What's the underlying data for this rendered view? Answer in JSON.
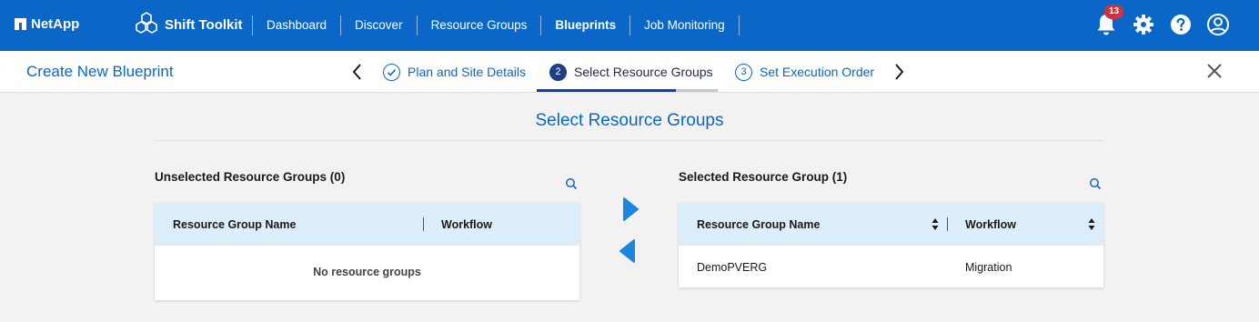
{
  "brand": {
    "name": "NetApp"
  },
  "product": {
    "name": "Shift Toolkit"
  },
  "nav": {
    "items": [
      {
        "label": "Dashboard",
        "active": false
      },
      {
        "label": "Discover",
        "active": false
      },
      {
        "label": "Resource Groups",
        "active": false
      },
      {
        "label": "Blueprints",
        "active": true
      },
      {
        "label": "Job Monitoring",
        "active": false
      }
    ],
    "notifications_count": "13"
  },
  "wizard": {
    "title": "Create New Blueprint",
    "steps": [
      {
        "number": "✓",
        "label": "Plan and Site Details",
        "state": "done"
      },
      {
        "number": "2",
        "label": "Select Resource Groups",
        "state": "current"
      },
      {
        "number": "3",
        "label": "Set Execution Order",
        "state": "todo"
      }
    ]
  },
  "main": {
    "title": "Select Resource Groups",
    "unselected": {
      "title": "Unselected Resource Groups (0)",
      "columns": [
        "Resource Group Name",
        "Workflow"
      ],
      "empty_message": "No resource groups",
      "rows": []
    },
    "selected": {
      "title": "Selected Resource Group (1)",
      "columns": [
        "Resource Group Name",
        "Workflow"
      ],
      "rows": [
        {
          "name": "DemoPVERG",
          "workflow": "Migration"
        }
      ]
    }
  },
  "colors": {
    "primary": "#0a67c8",
    "navbar": "#0a67c8",
    "table_header": "#ddeefb",
    "badge": "#d6303e",
    "arrow": "#1a86e0"
  }
}
